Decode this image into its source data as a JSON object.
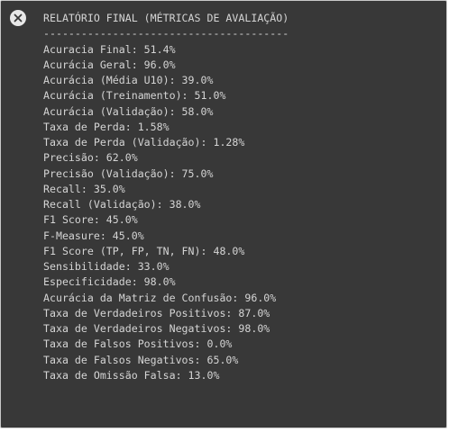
{
  "output": {
    "clear_icon": "close-circle-icon",
    "header": "RELATÓRIO FINAL (MÉTRICAS DE AVALIAÇÃO)",
    "separator": "---------------------------------------",
    "lines": [
      "Acuracia Final: 51.4%",
      "Acurácia Geral: 96.0%",
      "Acurácia (Média U10): 39.0%",
      "Acurácia (Treinamento): 51.0%",
      "Acurácia (Validação): 58.0%",
      "Taxa de Perda: 1.58%",
      "Taxa de Perda (Validação): 1.28%",
      "Precisão: 62.0%",
      "Precisão (Validação): 75.0%",
      "Recall: 35.0%",
      "Recall (Validação): 38.0%",
      "F1 Score: 45.0%",
      "F-Measure: 45.0%",
      "F1 Score (TP, FP, TN, FN): 48.0%",
      "Sensibilidade: 33.0%",
      "Especificidade: 98.0%",
      "Acurácia da Matriz de Confusão: 96.0%",
      "Taxa de Verdadeiros Positivos: 87.0%",
      "Taxa de Verdadeiros Negativos: 98.0%",
      "Taxa de Falsos Positivos: 0.0%",
      "Taxa de Falsos Negativos: 65.0%",
      "Taxa de Omissão Falsa: 13.0%"
    ]
  }
}
